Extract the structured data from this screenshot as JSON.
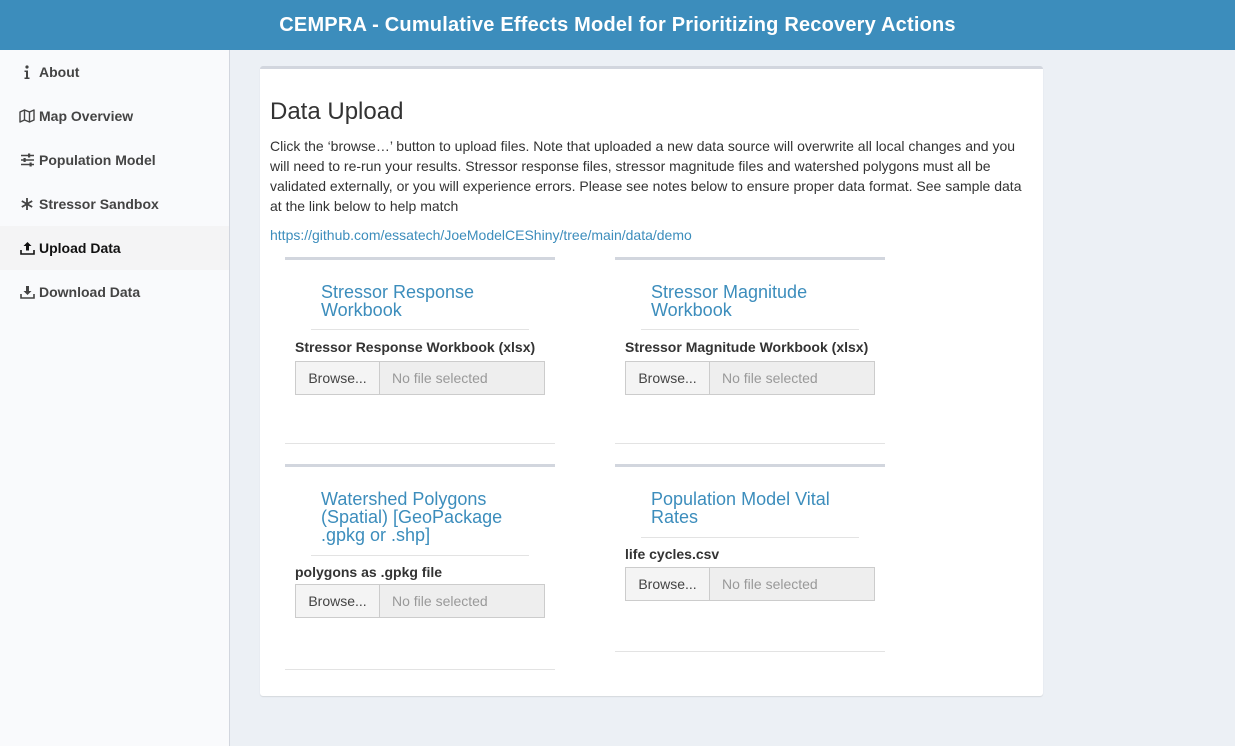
{
  "header": {
    "title": "CEMPRA - Cumulative Effects Model for Prioritizing Recovery Actions"
  },
  "sidebar": {
    "items": [
      {
        "label": "About",
        "icon": "info-icon"
      },
      {
        "label": "Map Overview",
        "icon": "map-icon"
      },
      {
        "label": "Population Model",
        "icon": "sliders-icon"
      },
      {
        "label": "Stressor Sandbox",
        "icon": "asterisk-icon"
      },
      {
        "label": "Upload Data",
        "icon": "upload-icon",
        "active": true
      },
      {
        "label": "Download Data",
        "icon": "download-icon"
      }
    ]
  },
  "main": {
    "title": "Data Upload",
    "intro": "Click the ‘browse…’ button to upload files. Note that uploaded a new data source will overwrite all local changes and you will need to re-run your results. Stressor response files, stressor magnitude files and watershed polygons must all be validated externally, or you will experience errors. Please see notes below to ensure proper data format. See sample data at the link below to help match",
    "link": "https://github.com/essatech/JoeModelCEShiny/tree/main/data/demo",
    "cards": [
      {
        "title": "Stressor Response Workbook",
        "label": "Stressor Response Workbook (xlsx)",
        "browse": "Browse...",
        "placeholder": "No file selected"
      },
      {
        "title": "Stressor Magnitude Workbook",
        "label": "Stressor Magnitude Workbook (xlsx)",
        "browse": "Browse...",
        "placeholder": "No file selected"
      },
      {
        "title": "Watershed Polygons (Spatial) [GeoPackage .gpkg or .shp]",
        "label": "polygons as .gpkg file",
        "browse": "Browse...",
        "placeholder": "No file selected"
      },
      {
        "title": "Population Model Vital Rates",
        "label": "life cycles.csv",
        "browse": "Browse...",
        "placeholder": "No file selected"
      }
    ]
  }
}
